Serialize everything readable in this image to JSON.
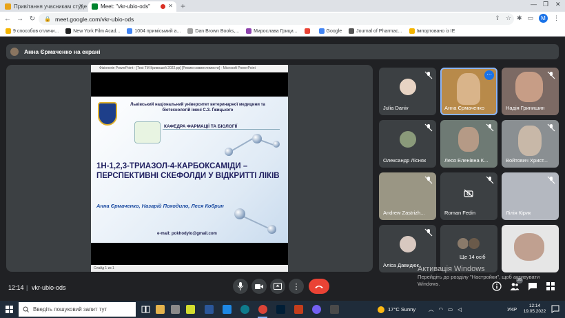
{
  "browser": {
    "tabs": [
      {
        "title": "Привітання учасникам студент",
        "favicon_color": "#e8a317"
      },
      {
        "title": "Meet: \"vkr-ubio-ods\"",
        "favicon_color": "#00832d",
        "recording": true
      }
    ],
    "url": "meet.google.com/vkr-ubio-ods",
    "profile_initial": "M",
    "bookmarks": [
      {
        "label": "9 способов отличи...",
        "color": "#f4b400"
      },
      {
        "label": "New York Film Acad...",
        "color": "#222222"
      },
      {
        "label": "1004 примісьмий а...",
        "color": "#4285f4"
      },
      {
        "label": "Dan Brown Books,...",
        "color": "#9e9e9e"
      },
      {
        "label": "Мирослава Грици...",
        "color": "#8e44ad"
      },
      {
        "label": "Google",
        "color": "#4285f4"
      },
      {
        "label": "Journal of Pharmac...",
        "color": "#555555"
      },
      {
        "label": "Імпортовано із IE",
        "color": "#f4b400"
      }
    ]
  },
  "meet": {
    "presenting_banner": "Анна Єрмаченко на екрані",
    "meeting_time": "12:14",
    "meeting_code": "vkr-ubio-ods",
    "participant_badge": "26",
    "slide": {
      "ppt_title": "Фізіологія PowerPoint - [Test ТМ Кривошей 2022.pp] [Режим совместимости] - Microsoft PowerPoint",
      "university": "Львівський національний університет ветеринарної медицини та біотехнологій імені С.З. Ґжицького",
      "department": "КАФЕДРА ФАРМАЦІЇ ТА БІОЛОГІЇ",
      "title": "1Н-1,2,3-ТРИАЗОЛ-4-КАРБОКСАМІДИ – ПЕРСПЕКТИВНІ СКЕФОЛДИ У ВІДКРИТТІ ЛІКІВ",
      "authors": "Анна Єрмаченко, Назарій Походило, Леся Кобрин",
      "email": "e-mail: pokhodylo@gmail.com",
      "status": "Слайд 1 из 1"
    },
    "participants": [
      {
        "name": "Julia Daniv",
        "bg": "#3c4043",
        "avatar": true,
        "muted": true
      },
      {
        "name": "Анна Єрмаченко",
        "bg": "#b88a4a",
        "speaking": true
      },
      {
        "name": "Надія Гринишин",
        "bg": "#7c6a64",
        "muted": true
      },
      {
        "name": "Олександр Лісняк",
        "bg": "#3c4043",
        "avatar": true,
        "muted": true
      },
      {
        "name": "Леся Еленівна К...",
        "bg": "#6e7a74",
        "muted": true
      },
      {
        "name": "Войтович Христ...",
        "bg": "#8a8f92",
        "muted": true
      },
      {
        "name": "Andrew Zastrizh...",
        "bg": "#9a9684",
        "muted": true
      },
      {
        "name": "Roman Fedin",
        "bg": "#3c4043",
        "camera_off": true,
        "muted": true
      },
      {
        "name": "Лілія Кірик",
        "bg": "#b4b8c0",
        "muted": true
      },
      {
        "name": "Аліса Давидюк",
        "bg": "#3c4043",
        "avatar": true,
        "muted": true
      },
      {
        "name": "Ще 14 осіб",
        "bg": "#3c4043"
      },
      {
        "name": "",
        "bg": "#e6e6e6"
      }
    ],
    "windows_watermark": {
      "line1": "Активація Windows",
      "line2": "Перейдіть до розділу \"Настройки\", щоб активувати Windows."
    }
  },
  "taskbar": {
    "search_placeholder": "Введіть пошуковий запит тут",
    "weather": "17°C Sunny",
    "language": "УКР",
    "time": "12:14",
    "date": "19.05.2022"
  },
  "colors": {
    "meet_bg": "#202124",
    "tile_bg": "#3c4043",
    "end_call": "#ea4335",
    "accent": "#8ab4f8"
  }
}
